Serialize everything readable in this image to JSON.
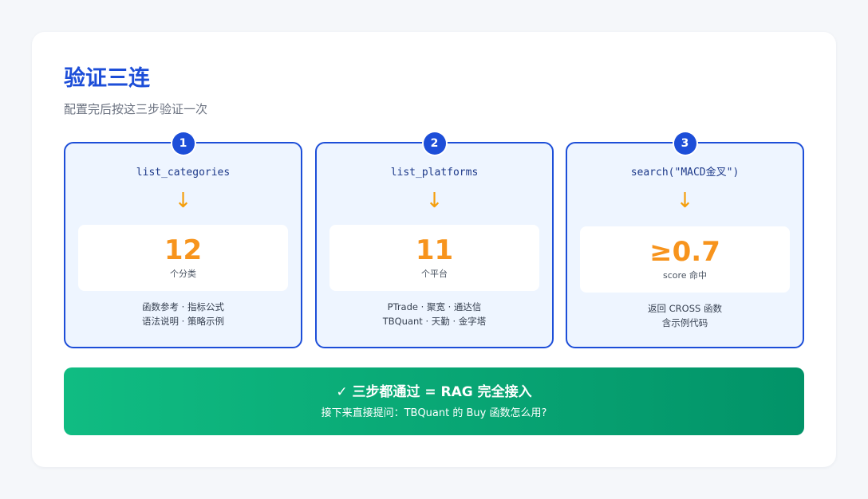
{
  "header": {
    "title": "验证三连",
    "subtitle": "配置完后按这三步验证一次"
  },
  "steps": [
    {
      "number": "1",
      "command": "list_categories",
      "arrow": "↓",
      "value": "12",
      "unit": "个分类",
      "desc": [
        "函数参考 · 指标公式",
        "语法说明 · 策略示例"
      ]
    },
    {
      "number": "2",
      "command": "list_platforms",
      "arrow": "↓",
      "value": "11",
      "unit": "个平台",
      "desc": [
        "PTrade · 聚宽 · 通达信",
        "TBQuant · 天勤 · 金字塔"
      ]
    },
    {
      "number": "3",
      "command": "search(\"MACD金叉\")",
      "arrow": "↓",
      "value": "≥0.7",
      "unit": "score 命中",
      "desc": [
        "返回 CROSS 函数",
        "含示例代码"
      ]
    }
  ],
  "banner": {
    "title": "✓ 三步都通过 = RAG 完全接入",
    "subtitle": "接下来直接提问：TBQuant 的 Buy 函数怎么用?"
  },
  "colors": {
    "accent_blue": "#1d4ed8",
    "card_bg": "#eef5ff",
    "value_orange": "#f7941d",
    "banner_green_start": "#10bc82",
    "banner_green_end": "#029368"
  }
}
